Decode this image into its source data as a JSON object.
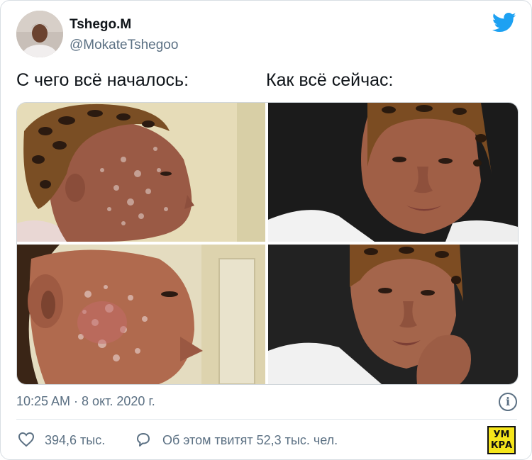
{
  "tweet": {
    "display_name": "Tshego.M",
    "handle": "@MokateTshegoo",
    "caption_left": "С чего всё началось:",
    "caption_right": "Как всё сейчас:",
    "timestamp": "10:25 AM · 8 окт. 2020 г.",
    "likes_text": "394,6 тыс.",
    "retweets_text": "Об этом твитят 52,3 тыс. чел."
  },
  "logo": {
    "line1": "УМ",
    "line2": "КРА"
  },
  "icons": {
    "bird": "twitter-bird-icon",
    "info": "info-icon",
    "heart": "heart-icon",
    "reply": "speech-bubble-icon"
  },
  "colors": {
    "twitter_blue": "#1da1f2",
    "text_primary": "#0f1419",
    "text_secondary": "#5b7083",
    "logo_yellow": "#f5e51b"
  }
}
